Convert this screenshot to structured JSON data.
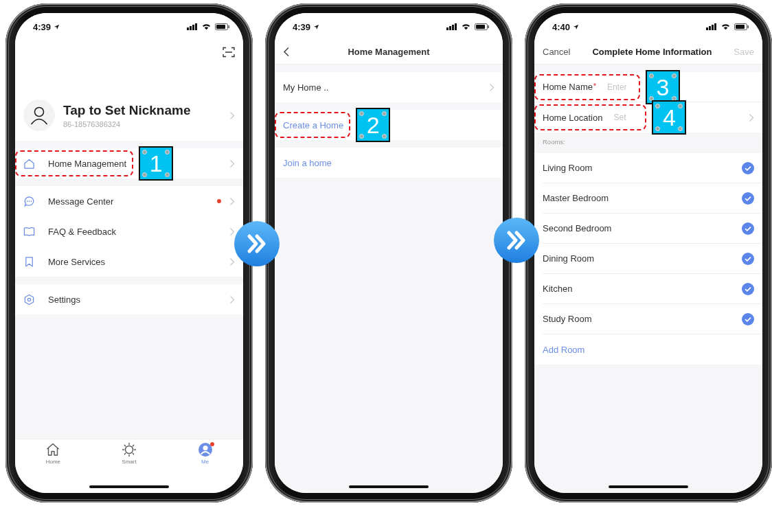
{
  "screens": [
    {
      "kind": "profile",
      "time": "4:39",
      "profile": {
        "name": "Tap to Set Nickname",
        "phone": "86-18576386324"
      },
      "menu_groups": [
        {
          "items": [
            {
              "kind": "home",
              "label": "Home Management",
              "badge": false,
              "highlighted": true,
              "step": "1"
            }
          ]
        },
        {
          "items": [
            {
              "kind": "message",
              "label": "Message Center",
              "badge": true,
              "highlighted": false
            },
            {
              "kind": "book",
              "label": "FAQ & Feedback",
              "badge": false,
              "highlighted": false
            },
            {
              "kind": "bookmark",
              "label": "More Services",
              "badge": false,
              "highlighted": false
            }
          ]
        },
        {
          "items": [
            {
              "kind": "settings",
              "label": "Settings",
              "badge": false,
              "highlighted": false
            }
          ]
        }
      ],
      "tab_bar": [
        {
          "kind": "home",
          "label": "Home",
          "selected": false,
          "badge": false
        },
        {
          "kind": "smart",
          "label": "Smart",
          "selected": false,
          "badge": false
        },
        {
          "kind": "me",
          "label": "Me",
          "selected": true,
          "badge": true
        }
      ]
    },
    {
      "kind": "home_management",
      "time": "4:39",
      "title": "Home Management",
      "items": [
        {
          "label": "My Home ..",
          "kind": "plain",
          "chevron": true,
          "highlighted": false
        },
        {
          "label": "Create a Home",
          "kind": "link",
          "chevron": false,
          "highlighted": true,
          "step": "2"
        },
        {
          "label": "Join a home",
          "kind": "link",
          "chevron": false,
          "highlighted": false
        }
      ]
    },
    {
      "kind": "home_info",
      "time": "4:40",
      "cancel": "Cancel",
      "title": "Complete Home Information",
      "save": {
        "label": "Save",
        "disabled": true
      },
      "fields": [
        {
          "label": "Home Name",
          "required_mark": "*",
          "placeholder": "Enter",
          "chevron": false,
          "highlighted": true,
          "step": "3"
        },
        {
          "label": "Home Location",
          "placeholder": "Set",
          "chevron": true,
          "highlighted": true,
          "step": "4"
        }
      ],
      "rooms_header": "Rooms:",
      "rooms": [
        {
          "name": "Living Room",
          "checked": true
        },
        {
          "name": "Master Bedroom",
          "checked": true
        },
        {
          "name": "Second Bedroom",
          "checked": true
        },
        {
          "name": "Dining Room",
          "checked": true
        },
        {
          "name": "Kitchen",
          "checked": true
        },
        {
          "name": "Study Room",
          "checked": true
        }
      ],
      "add_room": "Add Room"
    }
  ]
}
